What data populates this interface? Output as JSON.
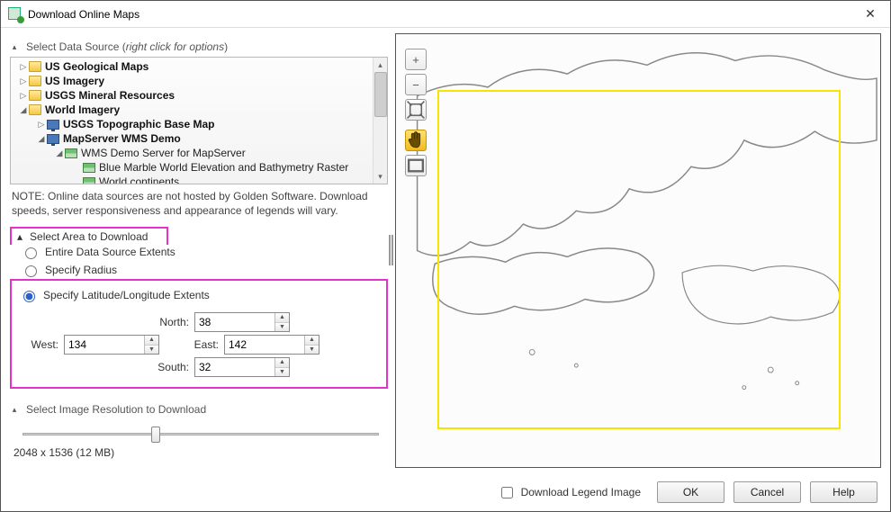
{
  "window": {
    "title": "Download Online Maps"
  },
  "sections": {
    "data_source_header": "Select Data Source (",
    "data_source_hint": "right click for options",
    "data_source_header_end": ")",
    "select_area_header": "Select Area to Download",
    "resolution_header": "Select Image Resolution to Download"
  },
  "tree": [
    {
      "indent": 0,
      "twisty": "▷",
      "icon": "folder",
      "bold": true,
      "label": "US Geological Maps"
    },
    {
      "indent": 0,
      "twisty": "▷",
      "icon": "folder",
      "bold": true,
      "label": "US Imagery"
    },
    {
      "indent": 0,
      "twisty": "▷",
      "icon": "folder",
      "bold": true,
      "label": "USGS Mineral Resources"
    },
    {
      "indent": 0,
      "twisty": "◢",
      "icon": "folder",
      "bold": true,
      "label": "World Imagery"
    },
    {
      "indent": 1,
      "twisty": "▷",
      "icon": "monitor",
      "bold": true,
      "label": "USGS Topographic Base Map"
    },
    {
      "indent": 1,
      "twisty": "◢",
      "icon": "monitor",
      "bold": true,
      "label": "MapServer WMS Demo"
    },
    {
      "indent": 2,
      "twisty": "◢",
      "icon": "raster",
      "bold": false,
      "label": "WMS Demo Server for MapServer"
    },
    {
      "indent": 3,
      "twisty": "",
      "icon": "raster",
      "bold": false,
      "label": "Blue Marble World Elevation and Bathymetry Raster"
    },
    {
      "indent": 3,
      "twisty": "",
      "icon": "raster",
      "bold": false,
      "label": "World continents"
    }
  ],
  "note": "NOTE: Online data sources are not hosted by Golden Software.  Download speeds, server responsiveness and appearance of legends will vary.",
  "area": {
    "radio_entire": "Entire Data Source Extents",
    "radio_radius": "Specify Radius",
    "radio_extents": "Specify Latitude/Longitude Extents",
    "labels": {
      "north": "North:",
      "south": "South:",
      "east": "East:",
      "west": "West:"
    },
    "values": {
      "north": "38",
      "south": "32",
      "east": "142",
      "west": "134"
    }
  },
  "resolution": {
    "label": "2048 x 1536  (12 MB)",
    "thumb_pct": 36
  },
  "footer": {
    "chk_legend": "Download Legend Image",
    "ok": "OK",
    "cancel": "Cancel",
    "help": "Help"
  },
  "tools": {
    "zoom_in": "+",
    "zoom_out": "−",
    "ext": "⤢",
    "pan": "✋",
    "rect": "□"
  }
}
